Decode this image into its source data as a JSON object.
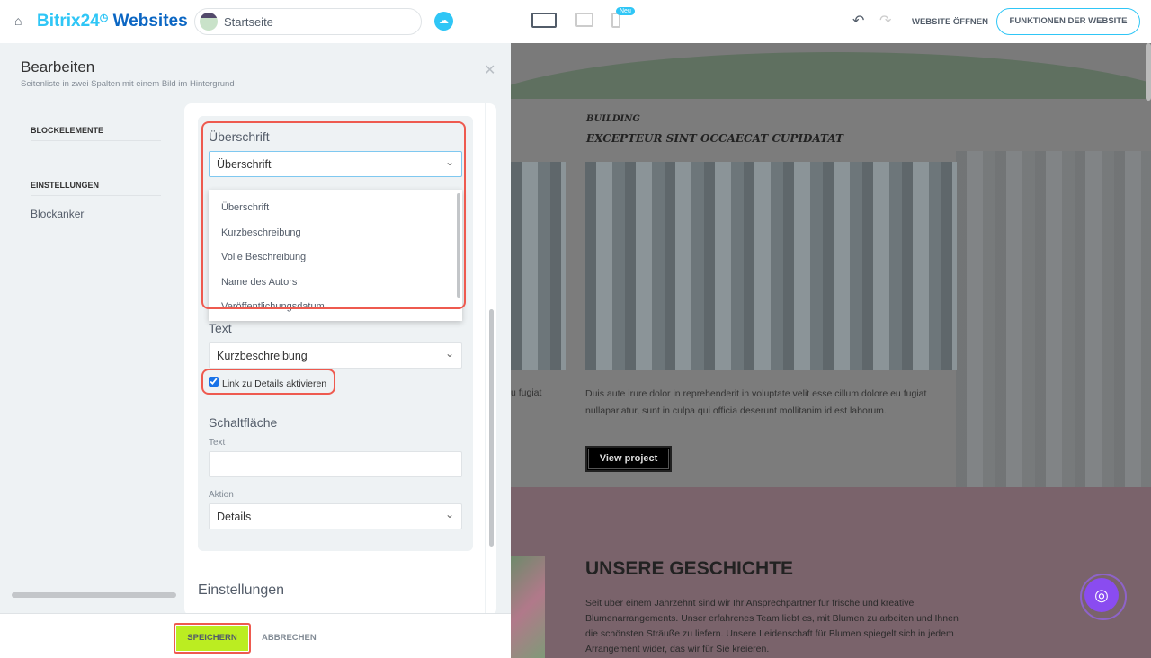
{
  "topbar": {
    "brand_light": "Bitrix24",
    "brand_bold": "Websites",
    "page_name": "Startseite",
    "new_badge": "Neu",
    "open_website": "WEBSITE ÖFFNEN",
    "site_features": "FUNKTIONEN DER WEBSITE"
  },
  "panel": {
    "title": "Bearbeiten",
    "subtitle": "Seitenliste in zwei Spalten mit einem Bild im Hintergrund",
    "nav": {
      "block_elements": "BLOCKELEMENTE",
      "settings": "EINSTELLUNGEN",
      "anchor": "Blockanker"
    },
    "heading_label": "Überschrift",
    "heading_value": "Überschrift",
    "heading_options": [
      "Überschrift",
      "Kurzbeschreibung",
      "Volle Beschreibung",
      "Name des Autors",
      "Veröffentlichungsdatum"
    ],
    "text_label": "Text",
    "text_value": "Kurzbeschreibung",
    "link_checkbox": "Link zu Details aktivieren",
    "link_checked": true,
    "button_section": "Schaltfläche",
    "button_text_label": "Text",
    "button_text_value": "",
    "action_label": "Aktion",
    "action_value": "Details",
    "settings_section": "Einstellungen",
    "save": "SPEICHERN",
    "cancel": "ABBRECHEN"
  },
  "preview": {
    "kicker": "BUILDING",
    "headline": "EXCEPTEUR SINT OCCAECAT CUPIDATAT",
    "left_text": "u fugiat",
    "body": "Duis aute irure dolor in reprehenderit in voluptate velit esse cillum dolore eu fugiat nullapariatur, sunt in culpa qui officia deserunt mollitanim id est laborum.",
    "view_project": "View project",
    "story_title": "UNSERE GESCHICHTE",
    "story_text": "Seit über einem Jahrzehnt sind wir Ihr Ansprechpartner für frische und kreative Blumenarrangements. Unser erfahrenes Team liebt es, mit Blumen zu arbeiten und Ihnen die schönsten Sträuße zu liefern. Unsere Leidenschaft für Blumen spiegelt sich in jedem Arrangement wider, das wir für Sie kreieren."
  }
}
